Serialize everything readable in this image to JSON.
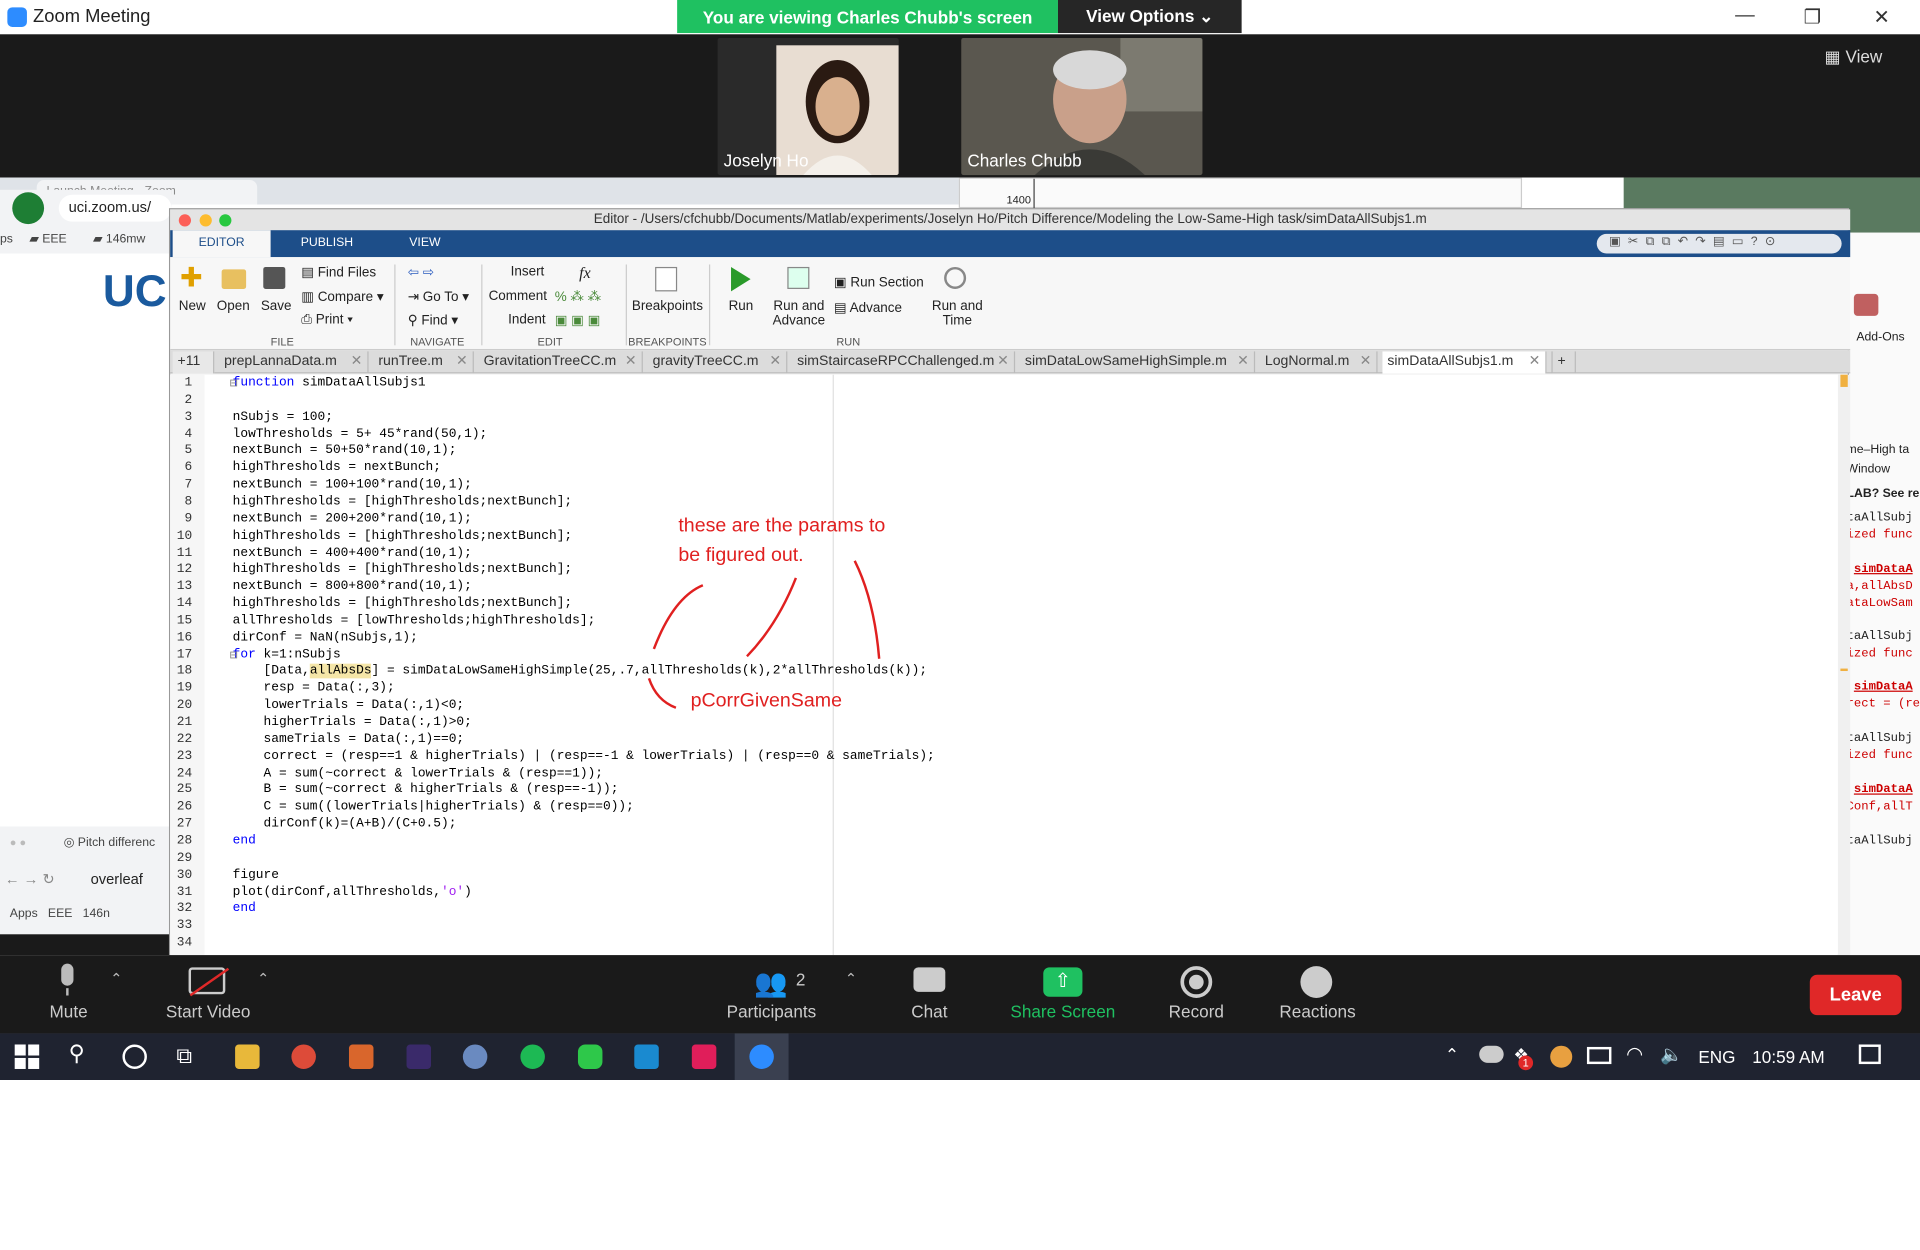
{
  "zoom": {
    "title": "Zoom Meeting",
    "banner_text": "You are viewing Charles Chubb's screen",
    "view_options": "View Options ⌄",
    "view_button": "View",
    "participants_video": [
      {
        "name": "Joselyn Ho"
      },
      {
        "name": "Charles Chubb"
      }
    ]
  },
  "background": {
    "browser_tab": "Launch Meeting - Zoom",
    "address": "uci.zoom.us/",
    "bookmarks": [
      "ps",
      "EEE",
      "146mw"
    ],
    "logo": "UC",
    "overleaf_tab": "Pitch differenc",
    "overleaf_address": "overleaf",
    "overleaf_bookmarks": [
      "Apps",
      "EEE",
      "146n"
    ],
    "chart_tick": "1400",
    "right_panel": [
      "me–High ta",
      "Window",
      "LAB? See re",
      "taAllSubj",
      "ized func",
      "simDataA",
      "a,allAbsD",
      "ataLowSam",
      "taAllSubj",
      "ized func",
      "simDataA",
      "rect = (re",
      "taAllSubj",
      "ized func",
      "simDataA",
      "Conf,allT",
      "taAllSubj"
    ],
    "add_ons": "Add-Ons"
  },
  "editor": {
    "title": "Editor - /Users/cfchubb/Documents/Matlab/experiments/Joselyn Ho/Pitch Difference/Modeling the Low-Same-High task/simDataAllSubjs1.m",
    "ribbon_tabs": [
      "EDITOR",
      "PUBLISH",
      "VIEW"
    ],
    "file": {
      "new": "New",
      "open": "Open",
      "save": "Save",
      "find_files": "Find Files",
      "compare": "Compare",
      "print": "Print",
      "section": "FILE"
    },
    "navigate": {
      "go_to": "Go To",
      "find": "Find",
      "section": "NAVIGATE"
    },
    "edit": {
      "insert": "Insert",
      "comment": "Comment",
      "indent": "Indent",
      "fx": "fx",
      "section": "EDIT"
    },
    "breakpoints": {
      "label": "Breakpoints",
      "section": "BREAKPOINTS"
    },
    "run": {
      "run": "Run",
      "run_advance": "Run and\nAdvance",
      "run_section": "Run Section",
      "advance": "Advance",
      "run_time": "Run and\nTime",
      "section": "RUN"
    },
    "tab_counter": "+11",
    "file_tabs": [
      "prepLannaData.m",
      "runTree.m",
      "GravitationTreeCC.m",
      "gravityTreeCC.m",
      "simStaircaseRPCChallenged.m",
      "simDataLowSameHighSimple.m",
      "LogNormal.m",
      "simDataAllSubjs1.m"
    ],
    "add_tab": "+",
    "code_lines": [
      "function simDataAllSubjs1",
      "",
      "nSubjs = 100;",
      "lowThresholds = 5+ 45*rand(50,1);",
      "nextBunch = 50+50*rand(10,1);",
      "highThresholds = nextBunch;",
      "nextBunch = 100+100*rand(10,1);",
      "highThresholds = [highThresholds;nextBunch];",
      "nextBunch = 200+200*rand(10,1);",
      "highThresholds = [highThresholds;nextBunch];",
      "nextBunch = 400+400*rand(10,1);",
      "highThresholds = [highThresholds;nextBunch];",
      "nextBunch = 800+800*rand(10,1);",
      "highThresholds = [highThresholds;nextBunch];",
      "allThresholds = [lowThresholds;highThresholds];",
      "dirConf = NaN(nSubjs,1);",
      "for k=1:nSubjs",
      "    [Data,allAbsDs] = simDataLowSameHighSimple(25,.7,allThresholds(k),2*allThresholds(k));",
      "    resp = Data(:,3);",
      "    lowerTrials = Data(:,1)<0;",
      "    higherTrials = Data(:,1)>0;",
      "    sameTrials = Data(:,1)==0;",
      "    correct = (resp==1 & higherTrials) | (resp==-1 & lowerTrials) | (resp==0 & sameTrials);",
      "    A = sum(~correct & lowerTrials & (resp==1));",
      "    B = sum(~correct & higherTrials & (resp==-1));",
      "    C = sum((lowerTrials|higherTrials) & (resp==0));",
      "    dirConf(k)=(A+B)/(C+0.5);",
      "end",
      "",
      "figure",
      "plot(dirConf,allThresholds,'o')",
      "end",
      "",
      ""
    ],
    "annotations": {
      "params_line1": "these are the params to",
      "params_line2": "be figured out.",
      "pcorr": "pCorrGivenSame"
    }
  },
  "toolbar": {
    "mute": "Mute",
    "start_video": "Start Video",
    "participants": "Participants",
    "participant_count": "2",
    "chat": "Chat",
    "share_screen": "Share Screen",
    "record": "Record",
    "reactions": "Reactions",
    "leave": "Leave"
  },
  "taskbar": {
    "lang": "ENG",
    "time": "10:59 AM",
    "badge": "1"
  },
  "colors": {
    "zoom_green": "#1fc161",
    "leave_red": "#e02828",
    "matlab_blue": "#1d4e89",
    "keyword_blue": "#0000ff",
    "annotation_red": "#e02020"
  }
}
